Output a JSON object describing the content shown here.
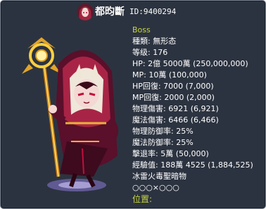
{
  "monster": {
    "name": "都昀斷",
    "id": "ID:9400294",
    "colors": {
      "panel_bg": "#2c3340",
      "border": "#7d8796",
      "accent": "#c7d63d",
      "text": "#ffffff"
    },
    "avatar_icon": "monster-portrait",
    "art_icon": "boss-monster-sprite"
  },
  "stats": {
    "boss": "Boss",
    "type": "種類: 無形态",
    "level": "等级: 176",
    "hp": "HP: 2億 5000萬 (250,000,000)",
    "mp": "MP: 10萬 (100,000)",
    "hp_recovery": "HP回復: 7000 (7,000)",
    "mp_recovery": "MP回復: 2000 (2,000)",
    "physical_damage": "物理傷害: 6921 (6,921)",
    "magic_damage": "魔法傷害: 6466 (6,466)",
    "physical_defense": "物理防御率: 25%",
    "magic_defense": "魔法防御率: 25%",
    "knockback": "擊退率: 5萬 (50,000)",
    "exp": "經驗值: 188萬 4525 (1,884,525)",
    "elements": "冰雷火毒聖暗物",
    "element_marks": "○○○×○○○",
    "location": "位置:"
  }
}
